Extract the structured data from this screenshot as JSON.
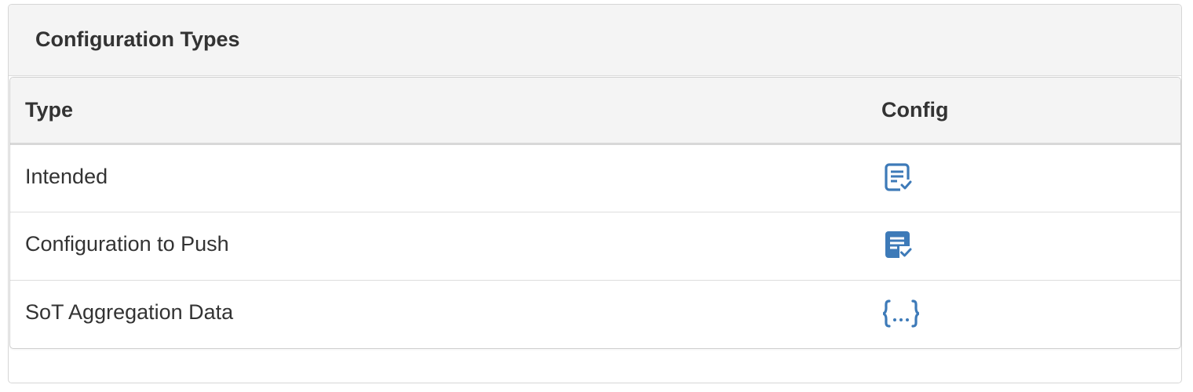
{
  "panel": {
    "title": "Configuration Types"
  },
  "table": {
    "columns": [
      "Type",
      "Config"
    ],
    "rows": [
      {
        "type": "Intended",
        "config_icon": "file-check-outline-icon"
      },
      {
        "type": "Configuration to Push",
        "config_icon": "file-check-solid-icon"
      },
      {
        "type": "SoT Aggregation Data",
        "config_icon": "code-json-icon"
      }
    ]
  },
  "colors": {
    "icon": "#3d7ab8",
    "header_bg": "#f4f4f4",
    "border": "#dddddd",
    "text": "#333333"
  }
}
